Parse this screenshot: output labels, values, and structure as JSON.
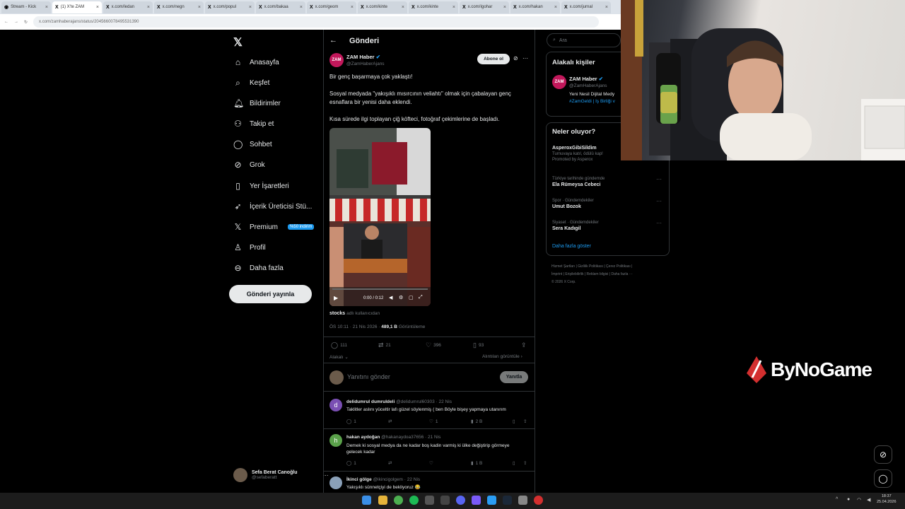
{
  "browser": {
    "tabs": [
      "Stream - Kick",
      "(1) X'te ZAM",
      "x.com/ledan",
      "x.com/negn",
      "x.com/popul",
      "x.com/bakaa",
      "x.com/geom",
      "x.com/kinte",
      "x.com/kinte",
      "x.com/Igohar",
      "x.com/hakan",
      "x.com/jurnal"
    ],
    "url": "x.com/zamhaberajans/status/2045660078495531390"
  },
  "nav": {
    "items": [
      "Anasayfa",
      "Keşfet",
      "Bildirimler",
      "Takip et",
      "Sohbet",
      "Grok",
      "Yer İşaretleri",
      "İçerik Üreticisi Stü...",
      "Premium",
      "Profil",
      "Daha fazla"
    ],
    "premium_badge": "%50 indirim",
    "post_button": "Gönderi yayınla",
    "profile_name": "Sefa Berat Canoğlu",
    "profile_handle": "@sefaberatt"
  },
  "post": {
    "header": "Gönderi",
    "author": "ZAM Haber",
    "handle": "@ZamHaberAjans",
    "avatar_text": "ZAM",
    "subscribe": "Abone ol",
    "para1": "Bir genç başarmaya çok yaklaştı!",
    "para2": "Sosyal medyada \"yakışıklı mısırcının veliahtı\" olmak için çabalayan genç esnaflara bir yenisi daha eklendi.",
    "para3": "Kısa sürede ilgi toplayan çiğ köfteci, fotoğraf çekimlerine de başladı.",
    "video_time": "0:00 / 0:12",
    "media_owner": "stocks",
    "media_suffix": "adlı kullanıcıdan",
    "timestamp": "ÖS 10:11 · 21 Nis 2026 ·",
    "views": "489,1 B",
    "views_label": "Görüntüleme",
    "replies": "111",
    "reposts": "21",
    "likes": "396",
    "bookmarks": "93",
    "related_left": "Alakalı",
    "related_right": "Alıntıları görüntüle",
    "reply_placeholder": "Yanıtını gönder",
    "reply_button": "Yanıtla"
  },
  "replies": [
    {
      "name": "delidumrul dumruldeli",
      "handle": "@delidumrul60303 · 22 Nis",
      "text": "Taklitler aslını yüceltir lafı güzel söylenmiş ( ben Böyle bişey yapmaya utanırım",
      "reply": "1",
      "like": "1",
      "views": "2 B",
      "avatar": "d",
      "color": "#7a4fb3"
    },
    {
      "name": "hakan aydoğan",
      "handle": "@hakanaydoa37656 · 21 Nis",
      "text": "Demek ki sosyal medya da ne kadar boş kadin varmiş ki ülke değiştirip görmeye gelecek kadar",
      "reply": "1",
      "like": "",
      "views": "1 B",
      "avatar": "h",
      "color": "#5aa14a"
    },
    {
      "name": "İkinci gölge",
      "handle": "@ikincigolgem · 22 Nis",
      "text": "Yakışıklı sünnetçiyi de bekliyoruz 😂",
      "reply": "",
      "like": "",
      "views": "",
      "avatar": "",
      "color": "#8aa0b8"
    }
  ],
  "right": {
    "search_placeholder": "Ara",
    "related_title": "Alakalı kişiler",
    "rel_name": "ZAM Haber",
    "rel_handle": "@ZamHaberAjans",
    "rel_bio1": "Yeni Nesil Dijital Medy",
    "rel_bio2": "#ZamGeldi | İş Birliği v",
    "trends_title": "Neler oluyor?",
    "trends": [
      {
        "cat": "",
        "name": "AsperoxGibiSildim",
        "sub": "Turnuvaya katıl, ödülü kap!",
        "promo": "Promoted by Asperox"
      },
      {
        "cat": "Türkiye tarihinde gündemde",
        "name": "Ela Rümeysa Cebeci",
        "sub": "",
        "promo": ""
      },
      {
        "cat": "Spor · Gündemdekiler",
        "name": "Umut Bozok",
        "sub": "",
        "promo": ""
      },
      {
        "cat": "Siyaset · Gündemdekiler",
        "name": "Sera Kadıgil",
        "sub": "",
        "promo": ""
      }
    ],
    "show_more": "Daha fazla göster",
    "footer1": "Hizmet Şartları  |  Gizlilik Politikası  |  Çerez Politikası  |",
    "footer2": "İmprint  |  Erişilebilirlik  |  Reklam bilgisi  |  Daha fazla ···",
    "footer3": "© 2026 X Corp."
  },
  "overlay": {
    "brand": "ByNoGame"
  },
  "taskbar": {
    "time": "18:37",
    "date": "25.04.2026"
  }
}
